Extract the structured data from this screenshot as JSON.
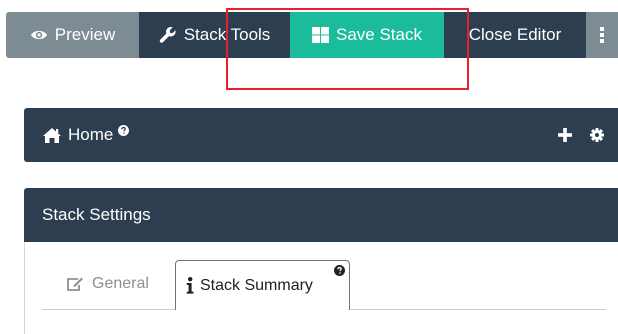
{
  "toolbar": {
    "preview_label": "Preview",
    "stack_tools_label": "Stack Tools",
    "save_stack_label": "Save Stack",
    "close_editor_label": "Close Editor"
  },
  "home": {
    "title": "Home"
  },
  "settings": {
    "title": "Stack Settings",
    "tabs": [
      {
        "label": "General",
        "active": false
      },
      {
        "label": "Stack Summary",
        "active": true
      }
    ]
  },
  "icons": {
    "preview": "eye-icon",
    "stack_tools": "wrench-icon",
    "save_stack": "grid-icon",
    "more": "ellipsis-vertical-icon",
    "home": "home-icon",
    "help": "question-circle-icon",
    "add": "plus-icon",
    "settings": "gear-icon",
    "general": "edit-icon",
    "summary": "info-icon"
  },
  "colors": {
    "dark_navy": "#2c3e50",
    "teal": "#1abc9c",
    "gray": "#7d8b93",
    "highlight_red": "#e8202a"
  }
}
